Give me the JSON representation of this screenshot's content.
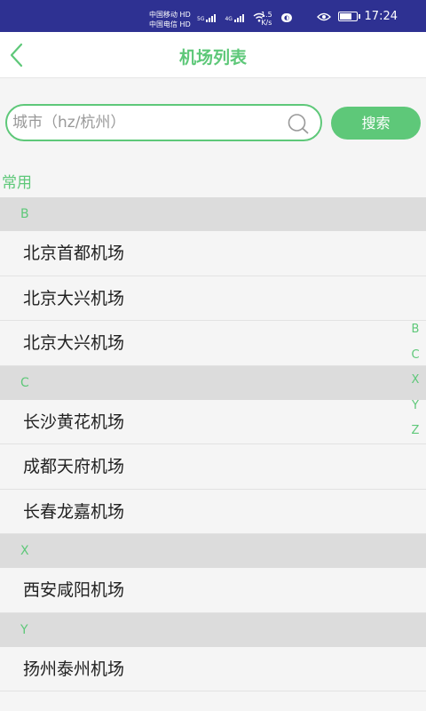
{
  "status_bar": {
    "carrier_1": "中国移动",
    "carrier_2": "中国电信",
    "hd_badge": "HD",
    "network": "5G",
    "network_2": "4G",
    "speed_value": "1.5",
    "speed_unit": "K/s",
    "time": "17:24"
  },
  "header": {
    "title": "机场列表"
  },
  "search": {
    "placeholder": "城市（hz/杭州）",
    "value": "",
    "button_label": "搜索"
  },
  "common_label": "常用",
  "groups": [
    {
      "letter": "B",
      "items": [
        "北京首都机场",
        "北京大兴机场",
        "北京大兴机场"
      ]
    },
    {
      "letter": "C",
      "items": [
        "长沙黄花机场",
        "成都天府机场",
        "长春龙嘉机场"
      ]
    },
    {
      "letter": "X",
      "items": [
        "西安咸阳机场"
      ]
    },
    {
      "letter": "Y",
      "items": [
        "扬州泰州机场"
      ]
    }
  ],
  "index_letters": [
    "B",
    "C",
    "X",
    "Y",
    "Z"
  ],
  "colors": {
    "accent": "#5ec879",
    "status_bar": "#2e3192",
    "group_header_bg": "#dcdcdc"
  },
  "icons": {
    "back": "chevron-left-icon",
    "search": "search-icon"
  },
  "battery_level": 0.8
}
